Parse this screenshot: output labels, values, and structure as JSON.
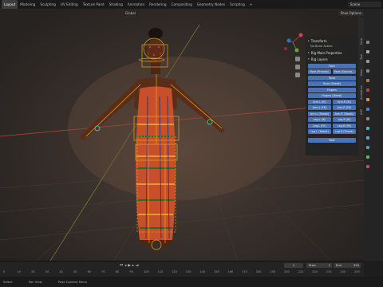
{
  "topbar": {
    "workspaces": [
      "Layout",
      "Modeling",
      "Sculpting",
      "UV Editing",
      "Texture Paint",
      "Shading",
      "Animation",
      "Rendering",
      "Compositing",
      "Geometry Nodes",
      "Scripting"
    ],
    "active": "Layout",
    "add_tab": "+",
    "scene_name": "Scene"
  },
  "viewport": {
    "shading_label": "Global",
    "options_label": "Pose Options"
  },
  "npanel": {
    "transform_header": "Transform",
    "bone_status": "No Bone Active",
    "rig_props_header": "Rig Main Properties",
    "rig_layers_header": "Rig Layers",
    "buttons": {
      "face": "Face",
      "face_primary": "Face (Primary)",
      "face_secondary": "Face (Second...",
      "torso": "Torso",
      "torso_tweak": "Torso (Tweak)",
      "fingers": "Fingers",
      "fingers_detail": "Fingers (Detail)",
      "arm_ik_l": "Arm.L (IK)",
      "arm_ik_r": "Arm.R (IK)",
      "arm_fk_l": "Arm.L (FK)",
      "arm_fk_r": "Arm.R (FK)",
      "arm_tweak_l": "Arm.L (Tweak)",
      "arm_tweak_r": "Arm.R (Tweak)",
      "leg_ik_l": "Leg.L (IK)",
      "leg_ik_r": "Leg.R (IK)",
      "leg_fk_l": "Leg.L (FK)",
      "leg_fk_r": "Leg.R (FK)",
      "leg_tweak_l": "Leg.L (Tweak)",
      "leg_tweak_r": "Leg.R (Tweak)",
      "root": "Root"
    }
  },
  "sidebar_tabs": [
    "Item",
    "Tool",
    "View",
    "Animation",
    "ARP"
  ],
  "timeline": {
    "current_frame": "1",
    "start_label": "Start",
    "start_value": "1",
    "end_label": "End",
    "end_value": "250",
    "ruler": [
      "0",
      "10",
      "20",
      "30",
      "40",
      "50",
      "60",
      "70",
      "80",
      "90",
      "100",
      "110",
      "120",
      "130",
      "140",
      "150",
      "160",
      "170",
      "180",
      "190",
      "200",
      "210",
      "220",
      "230",
      "240",
      "250"
    ]
  },
  "status": {
    "select": "Select",
    "pan": "Pan View",
    "context": "Pose Context Menu"
  },
  "colors": {
    "layer_button": "#4a72b6",
    "panel_bg": "#242424",
    "bone_outline": "#e8a317",
    "axis_red": "#b5433c",
    "axis_green": "#7f9a36"
  }
}
